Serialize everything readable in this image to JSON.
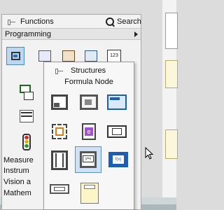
{
  "functions_palette": {
    "title": "Functions",
    "search_label": "Search",
    "category": "Programming",
    "subpalette_labels": [
      "Measure",
      "Instrum",
      "Vision a",
      "Mathem"
    ]
  },
  "structures_palette": {
    "title": "Structures",
    "hovered_item": "Formula Node",
    "items": [
      "flat-sequence",
      "while-loop",
      "case-structure",
      "diagram-disable",
      "event-structure",
      "local-variable",
      "for-loop",
      "formula-node",
      "global-variable",
      "shared-variable",
      "timed-structure"
    ]
  },
  "colors": {
    "selection": "#bcd7f0",
    "selection_border": "#4a86c8",
    "panel_bg": "#f2f2f2",
    "accent_blue": "#1a5fb4",
    "accent_orange": "#e07b12",
    "accent_purple": "#a64fd6"
  }
}
